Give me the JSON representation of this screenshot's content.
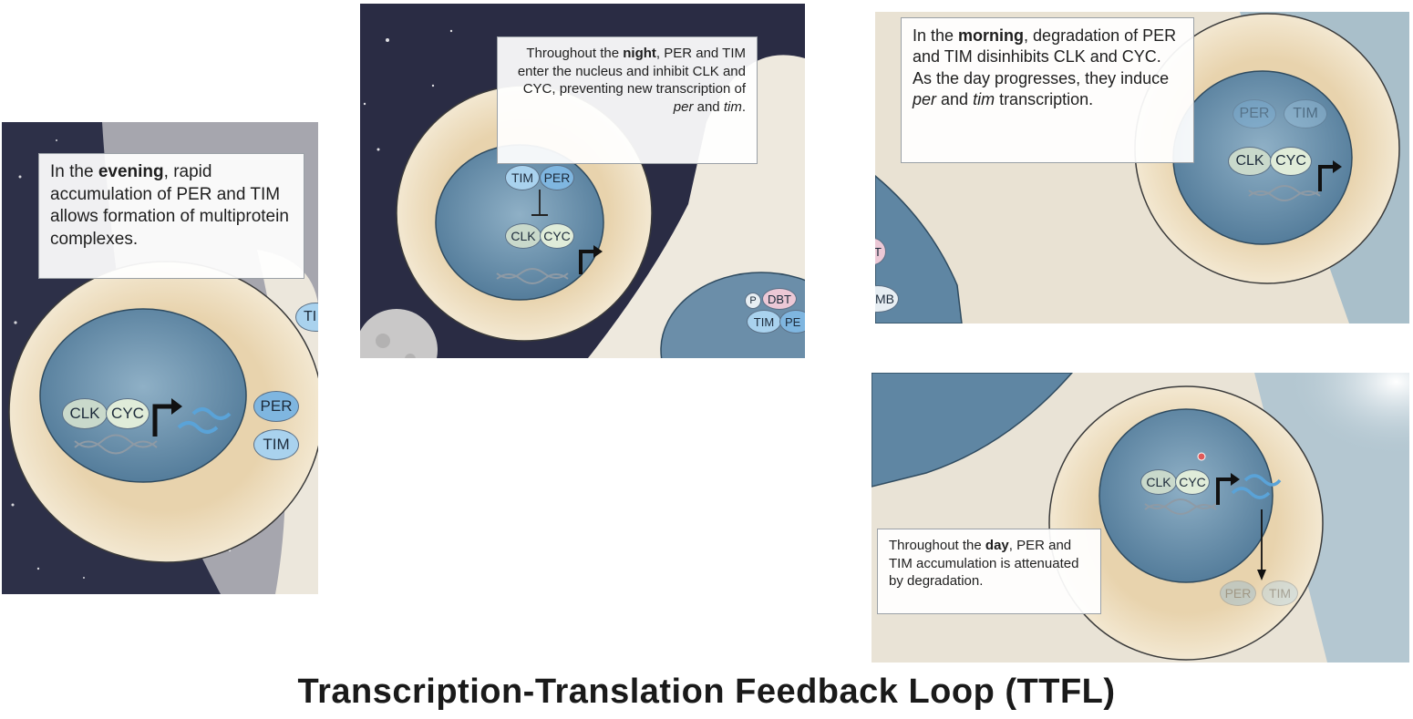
{
  "panels": {
    "evening": {
      "caption_pre": "In the ",
      "caption_bold": "evening",
      "caption_post": ", rapid accumulation of PER and TIM allows formation of multiprotein complexes.",
      "labels": {
        "clk": "CLK",
        "cyc": "CYC",
        "per": "PER",
        "tim": "TIM",
        "tim_edge": "TI"
      }
    },
    "night": {
      "caption_pre": "Throughout the ",
      "caption_bold": "night",
      "caption_mid": ", PER and TIM enter the nucleus and inhibit CLK and CYC, preventing new transcription of ",
      "caption_it1": "per",
      "caption_and": " and ",
      "caption_it2": "tim",
      "caption_end": ".",
      "labels": {
        "tim": "TIM",
        "per": "PER",
        "clk": "CLK",
        "cyc": "CYC",
        "p": "P",
        "dbt": "DBT",
        "tim2": "TIM",
        "pe": "PE"
      }
    },
    "morning": {
      "caption_pre": "In the ",
      "caption_bold": "morning",
      "caption_mid": ", degradation of PER and TIM disinhibits CLK and CYC. As the day progresses, they induce ",
      "caption_it1": "per",
      "caption_and": " and ",
      "caption_it2": "tim",
      "caption_end": " transcription.",
      "labels": {
        "per": "PER",
        "tim": "TIM",
        "clk": "CLK",
        "cyc": "CYC",
        "edge_t": "T",
        "edge_mb": "MB"
      }
    },
    "day": {
      "caption_pre": "Throughout the ",
      "caption_bold": "day",
      "caption_post": ", PER and TIM accumulation is attenuated by degradation.",
      "labels": {
        "clk": "CLK",
        "cyc": "CYC",
        "per": "PER",
        "tim": "TIM"
      }
    }
  },
  "title": "Transcription-Translation Feedback Loop (TTFL)",
  "colors": {
    "night_sky": "#2d3048",
    "cytoplasm": "#efe3c8",
    "nucleus": "#5f86a3",
    "per": "#7fb6e0",
    "tim": "#a9d2ee",
    "clk": "#c9d9cb",
    "cyc": "#e0ecd9"
  }
}
